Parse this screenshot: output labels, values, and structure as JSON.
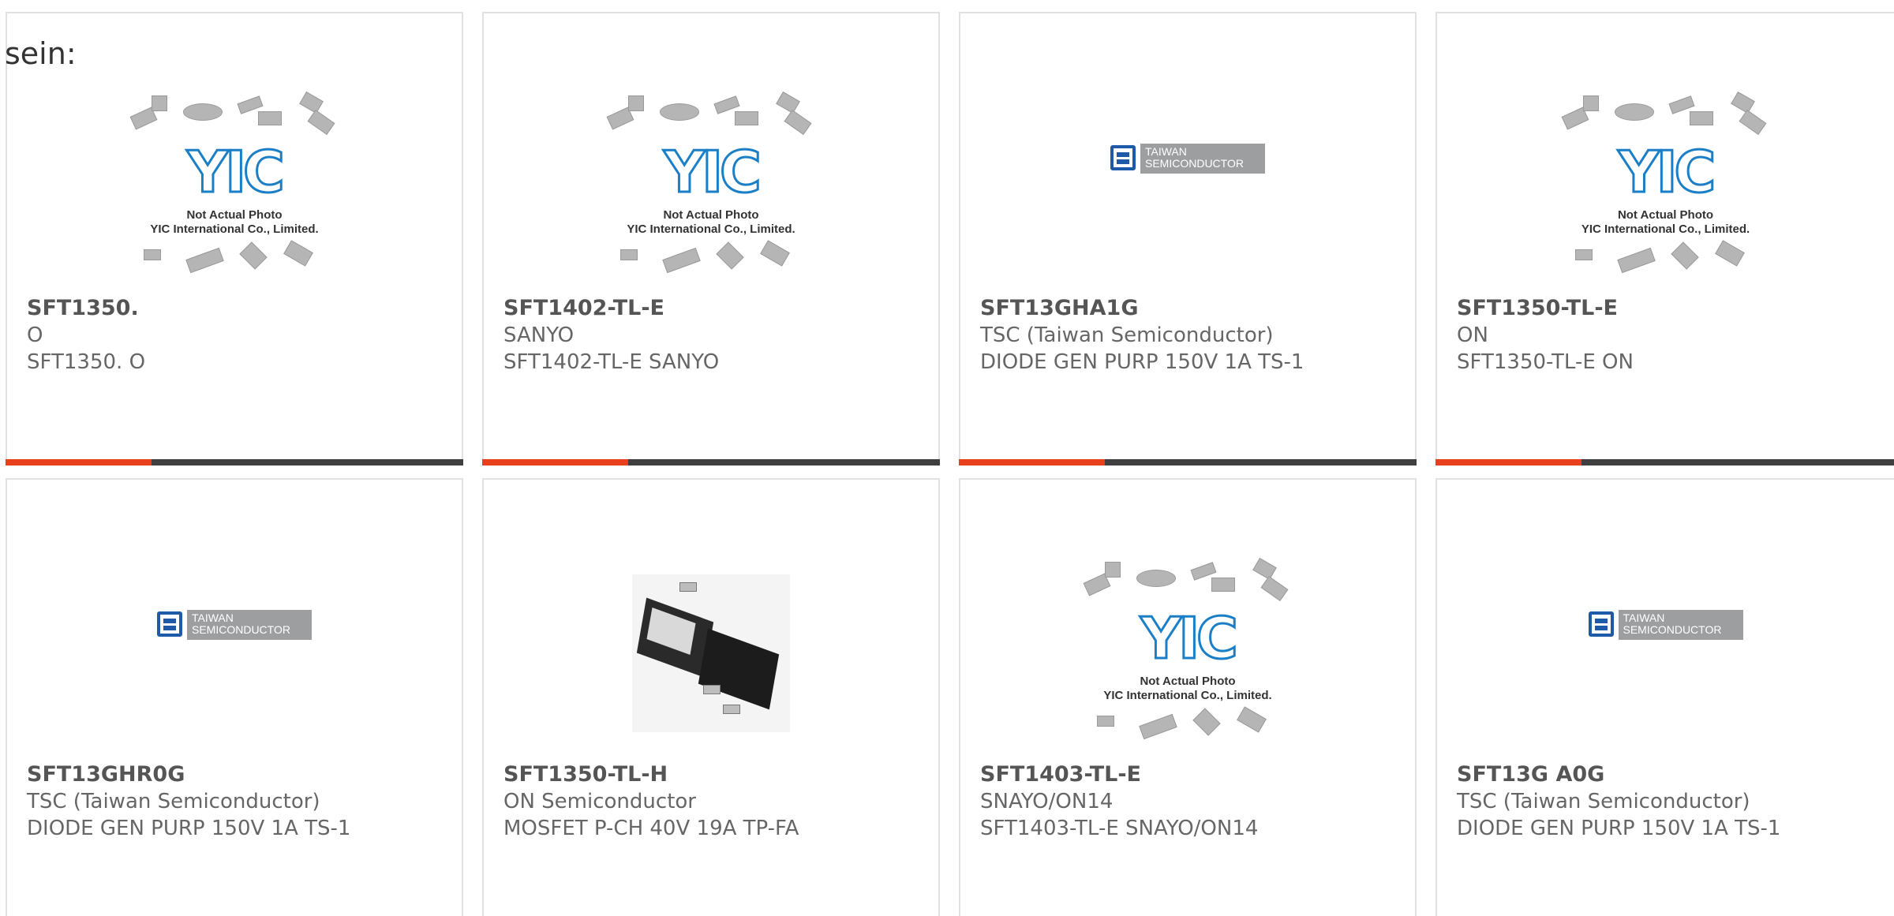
{
  "intro_text": "sein:",
  "placeholder": {
    "line1": "Not Actual Photo",
    "line2": "YIC International Co., Limited.",
    "logo": "YIC"
  },
  "tsc_logo": {
    "line1": "TAIWAN",
    "line2": "SEMICONDUCTOR"
  },
  "colors": {
    "accent": "#e8401c",
    "bar": "#3f3f3f",
    "border": "#e1e1e1"
  },
  "products": [
    {
      "part": "SFT1350.",
      "manufacturer": "O",
      "description": "SFT1350. O",
      "image": "yic-placeholder"
    },
    {
      "part": "SFT1402-TL-E",
      "manufacturer": "SANYO",
      "description": "SFT1402-TL-E SANYO",
      "image": "yic-placeholder"
    },
    {
      "part": "SFT13GHA1G",
      "manufacturer": "TSC (Taiwan Semiconductor)",
      "description": "DIODE GEN PURP 150V 1A TS-1",
      "image": "tsc-logo"
    },
    {
      "part": "SFT1350-TL-E",
      "manufacturer": "ON",
      "description": "SFT1350-TL-E ON",
      "image": "yic-placeholder"
    },
    {
      "part": "SFT13GHR0G",
      "manufacturer": "TSC (Taiwan Semiconductor)",
      "description": "DIODE GEN PURP 150V 1A TS-1",
      "image": "tsc-logo"
    },
    {
      "part": "SFT1350-TL-H",
      "manufacturer": "ON Semiconductor",
      "description": "MOSFET P-CH 40V 19A TP-FA",
      "image": "mosfet-photo"
    },
    {
      "part": "SFT1403-TL-E",
      "manufacturer": "SNAYO/ON14",
      "description": "SFT1403-TL-E SNAYO/ON14",
      "image": "yic-placeholder"
    },
    {
      "part": "SFT13G A0G",
      "manufacturer": "TSC (Taiwan Semiconductor)",
      "description": "DIODE GEN PURP 150V 1A TS-1",
      "image": "tsc-logo"
    }
  ]
}
